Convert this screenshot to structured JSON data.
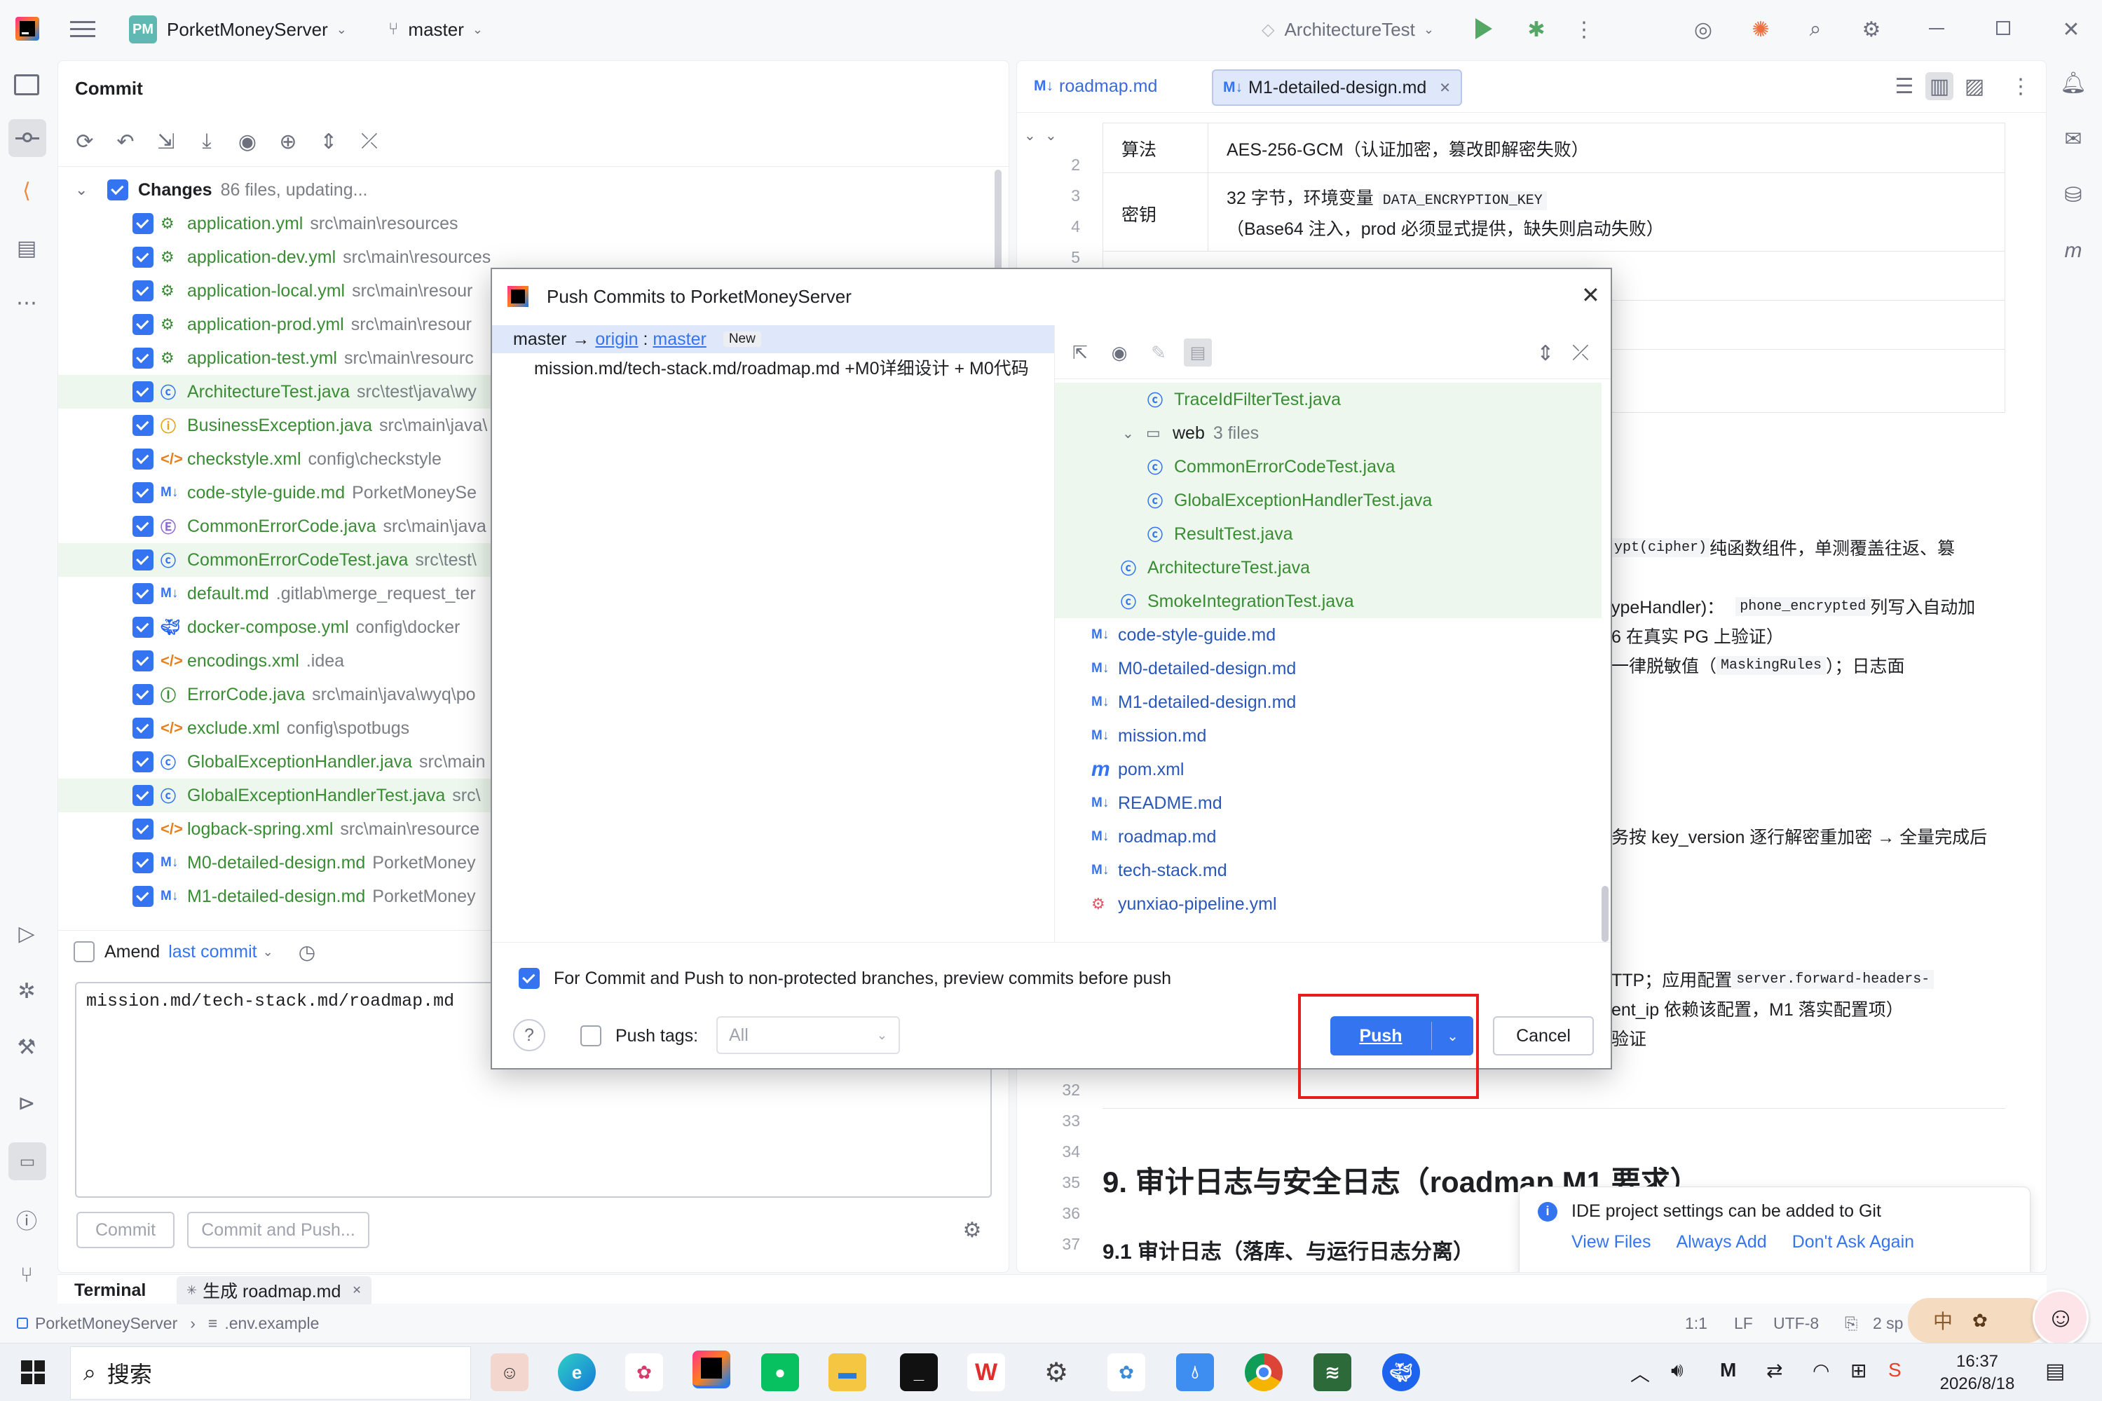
{
  "titlebar": {
    "project_badge": "PM",
    "project": "PorketMoneyServer",
    "branch": "master",
    "run_config": "ArchitectureTest"
  },
  "commit_panel": {
    "title": "Commit",
    "changes_label": "Changes",
    "changes_count": "86 files, updating...",
    "files": [
      {
        "name": "application.yml",
        "path": "src\\main\\resources",
        "icon": "yaml-icon"
      },
      {
        "name": "application-dev.yml",
        "path": "src\\main\\resources",
        "icon": "yaml-icon"
      },
      {
        "name": "application-local.yml",
        "path": "src\\main\\resour",
        "icon": "yaml-icon"
      },
      {
        "name": "application-prod.yml",
        "path": "src\\main\\resour",
        "icon": "yaml-icon"
      },
      {
        "name": "application-test.yml",
        "path": "src\\main\\resourc",
        "icon": "yaml-icon"
      },
      {
        "name": "ArchitectureTest.java",
        "path": "src\\test\\java\\wy",
        "icon": "java-class-icon"
      },
      {
        "name": "BusinessException.java",
        "path": "src\\main\\java\\",
        "icon": "exception-icon"
      },
      {
        "name": "checkstyle.xml",
        "path": "config\\checkstyle",
        "icon": "xml-icon"
      },
      {
        "name": "code-style-guide.md",
        "path": "PorketMoneySe",
        "icon": "markdown-icon"
      },
      {
        "name": "CommonErrorCode.java",
        "path": "src\\main\\java",
        "icon": "enum-icon"
      },
      {
        "name": "CommonErrorCodeTest.java",
        "path": "src\\test\\",
        "icon": "java-class-icon"
      },
      {
        "name": "default.md",
        "path": ".gitlab\\merge_request_ter",
        "icon": "markdown-icon"
      },
      {
        "name": "docker-compose.yml",
        "path": "config\\docker",
        "icon": "docker-icon"
      },
      {
        "name": "encodings.xml",
        "path": ".idea",
        "icon": "xml-icon"
      },
      {
        "name": "ErrorCode.java",
        "path": "src\\main\\java\\wyq\\po",
        "icon": "interface-icon"
      },
      {
        "name": "exclude.xml",
        "path": "config\\spotbugs",
        "icon": "xml-icon"
      },
      {
        "name": "GlobalExceptionHandler.java",
        "path": "src\\main",
        "icon": "java-class-icon"
      },
      {
        "name": "GlobalExceptionHandlerTest.java",
        "path": "src\\",
        "icon": "java-class-icon"
      },
      {
        "name": "logback-spring.xml",
        "path": "src\\main\\resource",
        "icon": "xml-icon"
      },
      {
        "name": "M0-detailed-design.md",
        "path": "PorketMoney",
        "icon": "markdown-icon"
      },
      {
        "name": "M1-detailed-design.md",
        "path": "PorketMoney",
        "icon": "markdown-icon"
      }
    ],
    "amend_label": "Amend",
    "last_commit_label": "last commit",
    "message": "mission.md/tech-stack.md/roadmap.md",
    "commit_button": "Commit",
    "commit_push_button": "Commit and Push..."
  },
  "bottom": {
    "terminal_label": "Terminal",
    "terminal_tab": "生成 roadmap.md",
    "breadcrumb_project": "PorketMoneyServer",
    "breadcrumb_file": ".env.example",
    "status": {
      "position": "1:1",
      "line_sep": "LF",
      "encoding": "UTF-8",
      "indent": "2 sp"
    }
  },
  "editor": {
    "tabs": [
      {
        "label": "roadmap.md",
        "active": false
      },
      {
        "label": "M1-detailed-design.md",
        "active": true
      }
    ],
    "line_numbers_top": [
      "2",
      "3",
      "4",
      "5"
    ],
    "table": [
      {
        "key": "算法",
        "value": "AES-256-GCM（认证加密，篡改即解密失败）"
      },
      {
        "key": "密钥",
        "value_pre": "32 字节，环境变量 ",
        "value_code": "DATA_ENCRYPTION_KEY",
        "value_post": "（Base64 注入，prod 必须显式提供，缺失则启动失败）"
      }
    ],
    "frag1_code": "ypt(cipher)",
    "frag1_text": " 纯函数组件，单测覆盖往返、篡",
    "frag2_text": "ypeHandler)：",
    "frag2_code": "phone_encrypted",
    "frag2_post": " 列写入自动加",
    "frag3_text": "6 在真实 PG 上验证）",
    "frag4_text": "一律脱敏值（",
    "frag4_code": "MaskingRules",
    "frag4_post": "）；日志面",
    "frag5_text": "务按 key_version 逐行解密重加密 → 全量完成后",
    "frag6_text": "TTP；应用配置 ",
    "frag6_code": "server.forward-headers-",
    "frag7_text": "ent_ip 依赖该配置，M1 落实配置项）",
    "frag8_text": "验证",
    "line_numbers_bottom": [
      "32",
      "33",
      "34",
      "35",
      "36",
      "37"
    ],
    "heading_9": "9. 审计日志与安全日志（roadmap M1 要求）",
    "heading_91": "9.1 审计日志（落库、与运行日志分离）"
  },
  "notification": {
    "text": "IDE project settings can be added to Git",
    "actions": [
      "View Files",
      "Always Add",
      "Don't Ask Again"
    ]
  },
  "dialog": {
    "title": "Push Commits to PorketMoneyServer",
    "branch_local": "master",
    "arrow": "→",
    "remote": "origin",
    "remote_sep": " : ",
    "remote_branch": "master",
    "new_badge": "New",
    "commit_message": "mission.md/tech-stack.md/roadmap.md +M0详细设计 + M0代码",
    "tree": [
      {
        "label": "TraceIdFilterTest.java",
        "indent": 3,
        "icon": "java-class-icon",
        "kind": "green"
      },
      {
        "label": "web",
        "count": "3 files",
        "indent": 2,
        "icon": "folder-icon",
        "kind": "folder"
      },
      {
        "label": "CommonErrorCodeTest.java",
        "indent": 3,
        "icon": "java-class-icon",
        "kind": "green"
      },
      {
        "label": "GlobalExceptionHandlerTest.java",
        "indent": 3,
        "icon": "java-class-icon",
        "kind": "green"
      },
      {
        "label": "ResultTest.java",
        "indent": 3,
        "icon": "java-class-icon",
        "kind": "green"
      },
      {
        "label": "ArchitectureTest.java",
        "indent": 1,
        "icon": "java-class-icon",
        "kind": "green"
      },
      {
        "label": "SmokeIntegrationTest.java",
        "indent": 1,
        "icon": "java-class-icon",
        "kind": "green"
      },
      {
        "label": "code-style-guide.md",
        "indent": 0,
        "icon": "markdown-icon",
        "kind": "blue"
      },
      {
        "label": "M0-detailed-design.md",
        "indent": 0,
        "icon": "markdown-icon",
        "kind": "blue"
      },
      {
        "label": "M1-detailed-design.md",
        "indent": 0,
        "icon": "markdown-icon",
        "kind": "blue"
      },
      {
        "label": "mission.md",
        "indent": 0,
        "icon": "markdown-icon",
        "kind": "blue"
      },
      {
        "label": "pom.xml",
        "indent": 0,
        "icon": "maven-icon",
        "kind": "blue"
      },
      {
        "label": "README.md",
        "indent": 0,
        "icon": "markdown-icon",
        "kind": "blue"
      },
      {
        "label": "roadmap.md",
        "indent": 0,
        "icon": "markdown-icon",
        "kind": "blue"
      },
      {
        "label": "tech-stack.md",
        "indent": 0,
        "icon": "markdown-icon",
        "kind": "blue"
      },
      {
        "label": "yunxiao-pipeline.yml",
        "indent": 0,
        "icon": "yaml-icon",
        "kind": "blue"
      }
    ],
    "preview_label": "For Commit and Push to non-protected branches, preview commits before push",
    "push_tags_label": "Push tags:",
    "push_tags_value": "All",
    "push_button": "Push",
    "cancel_button": "Cancel"
  },
  "taskbar": {
    "search_label": "搜索",
    "time": "16:37",
    "date": "2026/8/18",
    "ime": "中"
  }
}
